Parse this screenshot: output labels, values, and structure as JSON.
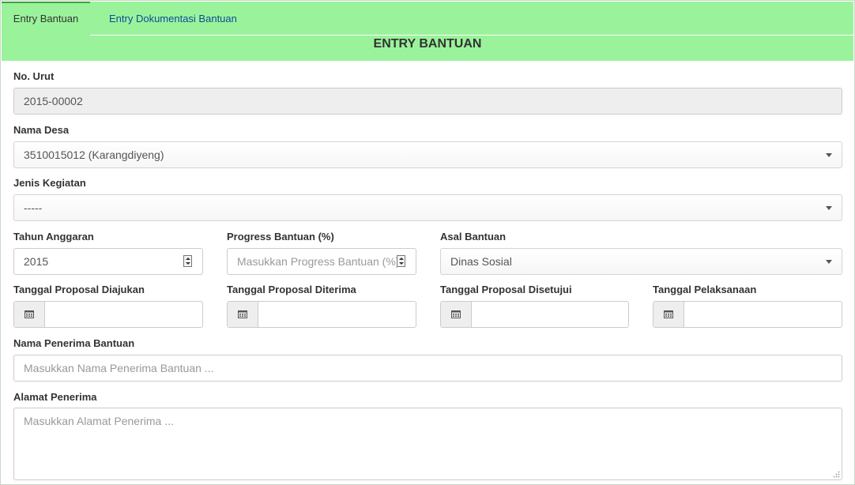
{
  "tabs": [
    {
      "label": "Entry Bantuan",
      "active": true
    },
    {
      "label": "Entry Dokumentasi Bantuan",
      "active": false
    }
  ],
  "header": {
    "title": "ENTRY BANTUAN"
  },
  "form": {
    "no_urut": {
      "label": "No. Urut",
      "value": "2015-00002"
    },
    "nama_desa": {
      "label": "Nama Desa",
      "value": "3510015012 (Karangdiyeng)"
    },
    "jenis_kegiatan": {
      "label": "Jenis Kegiatan",
      "value": "-----"
    },
    "tahun_anggaran": {
      "label": "Tahun Anggaran",
      "value": "2015"
    },
    "progress_bantuan": {
      "label": "Progress Bantuan (%)",
      "placeholder": "Masukkan Progress Bantuan (%)"
    },
    "asal_bantuan": {
      "label": "Asal Bantuan",
      "value": "Dinas Sosial"
    },
    "tgl_diajukan": {
      "label": "Tanggal Proposal Diajukan",
      "value": ""
    },
    "tgl_diterima": {
      "label": "Tanggal Proposal Diterima",
      "value": ""
    },
    "tgl_disetujui": {
      "label": "Tanggal Proposal Disetujui",
      "value": ""
    },
    "tgl_pelaksanaan": {
      "label": "Tanggal Pelaksanaan",
      "value": ""
    },
    "nama_penerima": {
      "label": "Nama Penerima Bantuan",
      "placeholder": "Masukkan Nama Penerima Bantuan ..."
    },
    "alamat_penerima": {
      "label": "Alamat Penerima",
      "placeholder": "Masukkan Alamat Penerima ..."
    }
  },
  "icons": {
    "calendar": "calendar-icon",
    "caret": "chevron-down-icon",
    "spinner": "spinner-icon"
  },
  "colors": {
    "tab_bar": "#9af39a",
    "active_tab_border": "#3fa33f",
    "inactive_tab_text": "#0b4d99"
  }
}
